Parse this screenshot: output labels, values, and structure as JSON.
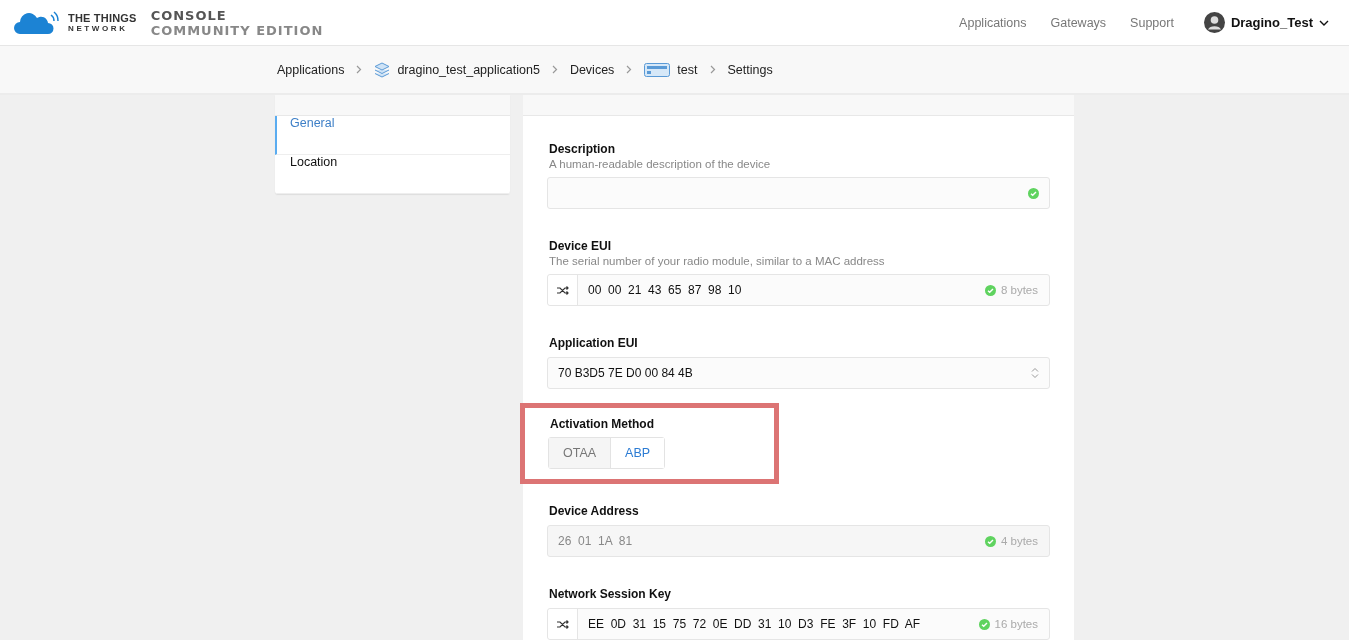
{
  "header": {
    "brand": {
      "line1": "THE THINGS",
      "line2": "NETWORK"
    },
    "product": {
      "line1": "CONSOLE",
      "line2": "COMMUNITY EDITION"
    },
    "nav": [
      "Applications",
      "Gateways",
      "Support"
    ],
    "user": {
      "name": "Dragino_Test"
    }
  },
  "breadcrumbs": [
    {
      "label": "Applications",
      "kind": "plain"
    },
    {
      "label": "dragino_test_application5",
      "kind": "application"
    },
    {
      "label": "Devices",
      "kind": "plain"
    },
    {
      "label": "test",
      "kind": "device"
    },
    {
      "label": "Settings",
      "kind": "plain"
    }
  ],
  "sidebar": {
    "items": [
      {
        "label": "General",
        "selected": true
      },
      {
        "label": "Location",
        "selected": false
      }
    ]
  },
  "fields": [
    {
      "kind": "text",
      "label": "Description",
      "hint": "A human-readable description of the device",
      "valid": true
    },
    {
      "kind": "hex",
      "label": "Device EUI",
      "hint": "The serial number of your radio module, similar to a MAC address",
      "value": "00  00  21  43  65  87  98  10",
      "size": "8 bytes",
      "valid": true,
      "disabled": false,
      "randomize": true
    },
    {
      "kind": "select",
      "label": "Application EUI",
      "value": "70 B3D5 7E D0 00 84 4B"
    },
    {
      "kind": "toggle",
      "label": "Activation Method",
      "highlighted": true,
      "options": [
        {
          "label": "OTAA",
          "selected": false
        },
        {
          "label": "ABP",
          "selected": true
        }
      ]
    },
    {
      "kind": "hex",
      "label": "Device Address",
      "value": "26  01  1A  81",
      "size": "4 bytes",
      "valid": true,
      "disabled": true,
      "randomize": false
    },
    {
      "kind": "hex",
      "label": "Network Session Key",
      "value": "EE  0D  31  15  75  72  0E  DD  31  10  D3  FE  3F  10  FD  AF",
      "size": "16 bytes",
      "valid": true,
      "disabled": false,
      "randomize": true
    }
  ]
}
